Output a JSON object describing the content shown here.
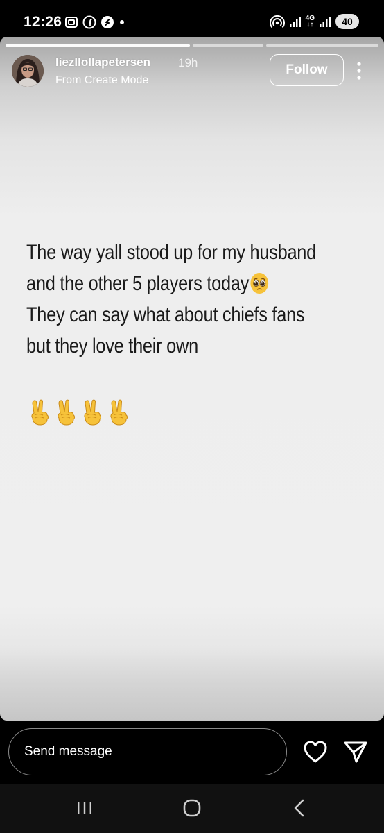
{
  "status_bar": {
    "time": "12:26",
    "battery": "40",
    "network": "4G"
  },
  "story": {
    "username": "liezllollapetersen",
    "time_ago": "19h",
    "subtitle": "From Create Mode",
    "follow_label": "Follow",
    "text_lines": [
      "The way yall stood up for my husband",
      "and the other 5 players today",
      "They can say what about chiefs fans",
      "but they love their own"
    ],
    "emoji_after_line_2": "pleading-face",
    "trailing_emojis": [
      "victory-hand",
      "victory-hand",
      "victory-hand",
      "victory-hand"
    ]
  },
  "message_bar": {
    "placeholder": "Send message"
  },
  "colors": {
    "background": "#000000",
    "story_text": "#1a1a1a",
    "emoji_yellow": "#f6c23a"
  }
}
